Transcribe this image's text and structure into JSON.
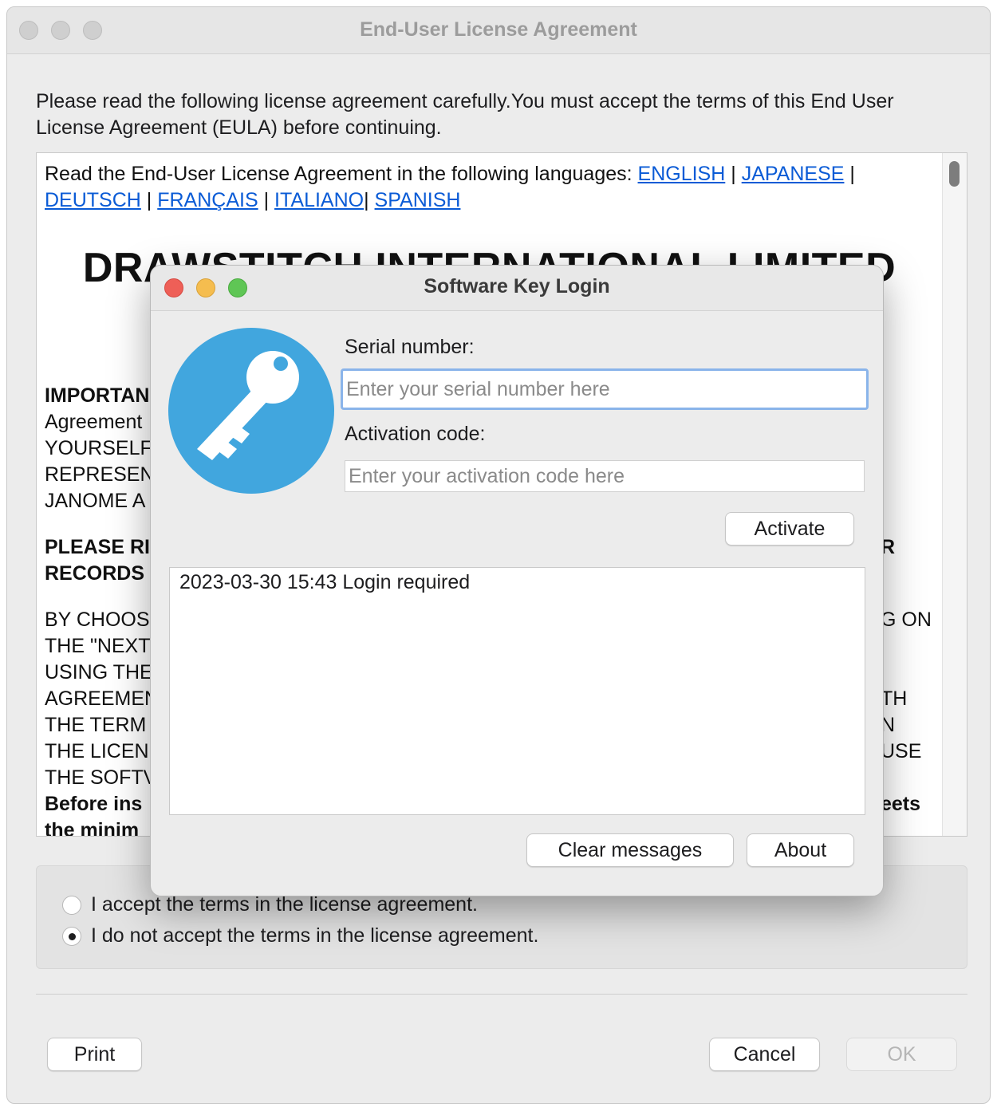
{
  "main_window": {
    "title": "End-User License Agreement",
    "intro": "Please read the following license agreement carefully.You must accept the terms of this End User License Agreement (EULA) before continuing."
  },
  "eula": {
    "languages_prefix": "Read the End-User License Agreement in the following languages:",
    "languages": [
      "ENGLISH",
      "JAPANESE",
      "DEUTSCH",
      "FRANÇAIS",
      "ITALIANO",
      "SPANISH"
    ],
    "heading": "DRAWSTITCH INTERNATIONAL LIMITED",
    "body_lines": [
      {
        "left": "IMPORTAN",
        "right": "",
        "bold": true
      },
      {
        "left": "Agreement",
        "right": "",
        "bold": false
      },
      {
        "left": "YOURSELF",
        "right": "",
        "bold": false
      },
      {
        "left": "REPRESEN",
        "right": "",
        "bold": false
      },
      {
        "left": "JANOME A",
        "right": "",
        "bold": false
      },
      {
        "left": "PLEASE RI",
        "right": "R",
        "bold": true
      },
      {
        "left": "RECORDS",
        "right": "",
        "bold": true
      },
      {
        "left": "BY CHOOS",
        "right": "G ON",
        "bold": false
      },
      {
        "left": "THE \"NEXT",
        "right": "",
        "bold": false
      },
      {
        "left": "USING THE",
        "right": "",
        "bold": false
      },
      {
        "left": "AGREEMEN",
        "right": "TH",
        "bold": false
      },
      {
        "left": "THE TERM",
        "right": "N",
        "bold": false
      },
      {
        "left": "THE LICEN",
        "right": "USE",
        "bold": false
      },
      {
        "left": "THE SOFTV",
        "right": "",
        "bold": false
      },
      {
        "left": "Before ins",
        "right": "eets",
        "bold": true
      },
      {
        "left": "the minim",
        "right": "",
        "bold": true
      }
    ]
  },
  "radios": {
    "accept_label": "I accept the terms in the license agreement.",
    "decline_label": "I do not accept the terms in the license agreement.",
    "selected": "decline"
  },
  "buttons": {
    "print": "Print",
    "cancel": "Cancel",
    "ok": "OK"
  },
  "dialog": {
    "title": "Software Key Login",
    "serial_label": "Serial number:",
    "serial_placeholder": "Enter your serial number here",
    "activation_label": "Activation code:",
    "activation_placeholder": "Enter your activation code here",
    "activate_button": "Activate",
    "messages": [
      "2023-03-30 15:43 Login required"
    ],
    "clear_button": "Clear messages",
    "about_button": "About",
    "icon": "key-icon",
    "icon_color": "#41a6de"
  }
}
